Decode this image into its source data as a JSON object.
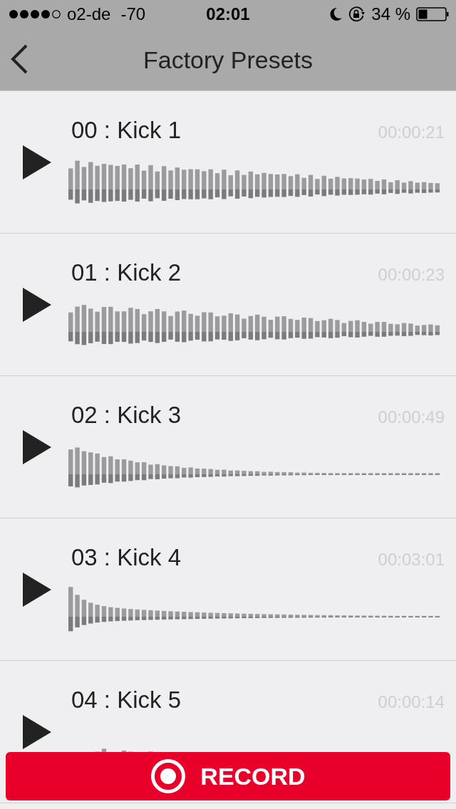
{
  "status_bar": {
    "carrier": "o2-de",
    "signal_reading": "-70",
    "time": "02:01",
    "battery": "34 %"
  },
  "nav": {
    "title": "Factory Presets"
  },
  "presets": [
    {
      "title": "00 : Kick 1",
      "duration": "00:00:21"
    },
    {
      "title": "01 : Kick 2",
      "duration": "00:00:23"
    },
    {
      "title": "02 : Kick 3",
      "duration": "00:00:49"
    },
    {
      "title": "03 : Kick 4",
      "duration": "00:03:01"
    },
    {
      "title": "04 : Kick 5",
      "duration": "00:00:14"
    }
  ],
  "record_button": {
    "label": "RECORD"
  }
}
